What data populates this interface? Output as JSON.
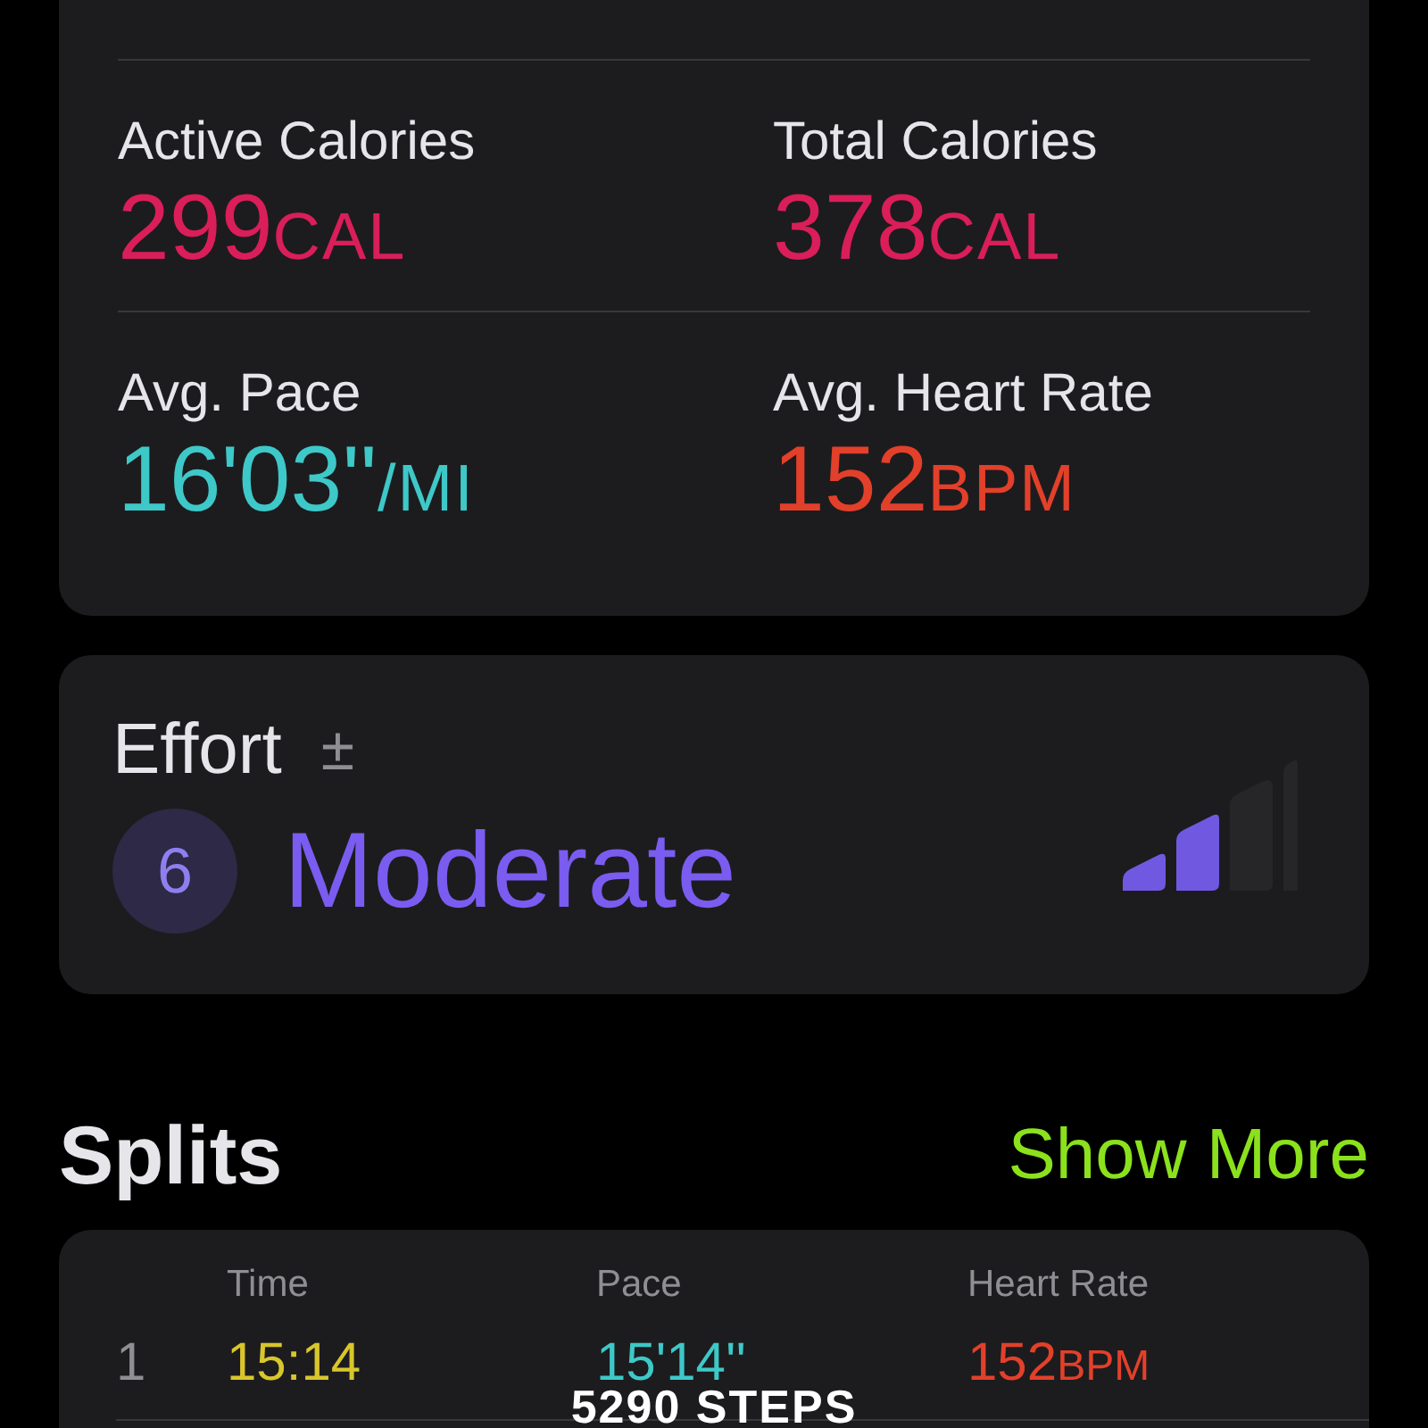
{
  "metrics": [
    {
      "label": "Active Calories",
      "value": "299",
      "unit": "CAL",
      "color": "#da1e5a"
    },
    {
      "label": "Total Calories",
      "value": "378",
      "unit": "CAL",
      "color": "#da1e5a"
    },
    {
      "label": "Avg. Pace",
      "value": "16'03''",
      "unit": "/MI",
      "color": "#3ec8c8"
    },
    {
      "label": "Avg. Heart Rate",
      "value": "152",
      "unit": "BPM",
      "color": "#e2402a"
    }
  ],
  "effort": {
    "title": "Effort",
    "adjust_icon": "±",
    "score": "6",
    "rating": "Moderate",
    "level": 0.5
  },
  "splits": {
    "title": "Splits",
    "show_more": "Show More",
    "columns": [
      "Time",
      "Pace",
      "Heart Rate"
    ],
    "rows": [
      {
        "index": "1",
        "time": "15:14",
        "pace": "15'14''",
        "heart_rate": "152",
        "heart_rate_unit": "BPM"
      }
    ]
  },
  "overlay_caption": "5290 STEPS"
}
